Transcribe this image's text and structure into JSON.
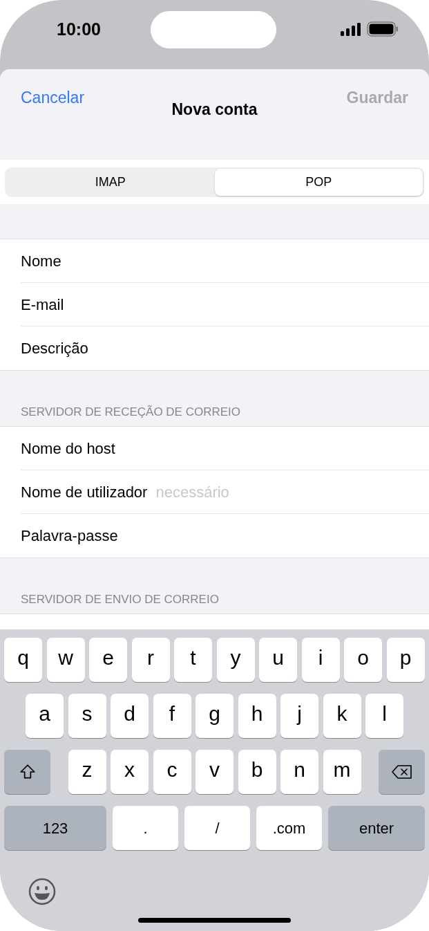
{
  "status_bar": {
    "time": "10:00"
  },
  "nav": {
    "cancel": "Cancelar",
    "title": "Nova conta",
    "save": "Guardar",
    "save_disabled": true
  },
  "segments": [
    {
      "label": "IMAP",
      "selected": false
    },
    {
      "label": "POP",
      "selected": true
    }
  ],
  "sections": [
    {
      "rows": [
        {
          "label": "Nome"
        },
        {
          "label": "E-mail"
        },
        {
          "label": "Descrição"
        }
      ]
    },
    {
      "header": "SERVIDOR DE RECEÇÃO DE CORREIO",
      "rows": [
        {
          "label": "Nome do host"
        },
        {
          "label": "Nome de utilizador",
          "placeholder": "necessário"
        },
        {
          "label": "Palavra-passe"
        }
      ]
    },
    {
      "header": "SERVIDOR DE ENVIO DE CORREIO"
    }
  ],
  "keyboard": {
    "rows": [
      {
        "keys": [
          {
            "kind": "letter",
            "label": "q"
          },
          {
            "kind": "letter",
            "label": "w"
          },
          {
            "kind": "letter",
            "label": "e"
          },
          {
            "kind": "letter",
            "label": "r"
          },
          {
            "kind": "letter",
            "label": "t"
          },
          {
            "kind": "letter",
            "label": "y"
          },
          {
            "kind": "letter",
            "label": "u"
          },
          {
            "kind": "letter",
            "label": "i"
          },
          {
            "kind": "letter",
            "label": "o"
          },
          {
            "kind": "letter",
            "label": "p"
          }
        ]
      },
      {
        "keys": [
          {
            "kind": "letter",
            "label": "a"
          },
          {
            "kind": "letter",
            "label": "s"
          },
          {
            "kind": "letter",
            "label": "d"
          },
          {
            "kind": "letter",
            "label": "f"
          },
          {
            "kind": "letter",
            "label": "g"
          },
          {
            "kind": "letter",
            "label": "h"
          },
          {
            "kind": "letter",
            "label": "j"
          },
          {
            "kind": "letter",
            "label": "k"
          },
          {
            "kind": "letter",
            "label": "l"
          }
        ]
      },
      {
        "keys": [
          {
            "kind": "shift"
          },
          {
            "kind": "letter",
            "label": "z"
          },
          {
            "kind": "letter",
            "label": "x"
          },
          {
            "kind": "letter",
            "label": "c"
          },
          {
            "kind": "letter",
            "label": "v"
          },
          {
            "kind": "letter",
            "label": "b"
          },
          {
            "kind": "letter",
            "label": "n"
          },
          {
            "kind": "letter",
            "label": "m"
          },
          {
            "kind": "delete"
          }
        ]
      },
      {
        "keys": [
          {
            "kind": "numbers",
            "label": "123"
          },
          {
            "kind": "symbol",
            "label": "."
          },
          {
            "kind": "symbol",
            "label": "/"
          },
          {
            "kind": "symbol",
            "label": ".com"
          },
          {
            "kind": "enter",
            "label": "enter"
          }
        ]
      }
    ]
  }
}
